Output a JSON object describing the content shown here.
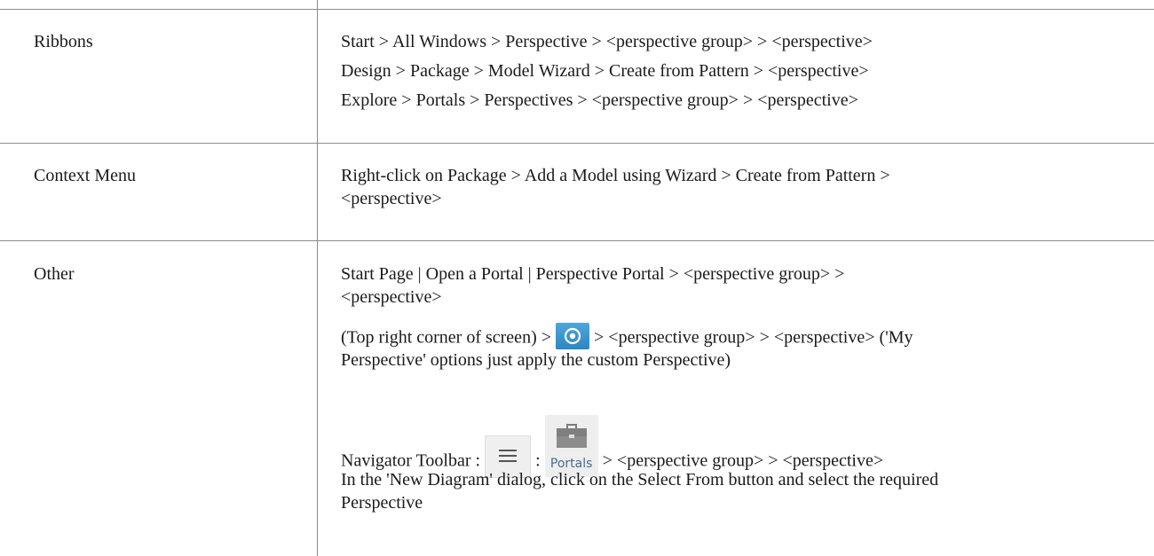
{
  "rows": [
    {
      "label": "Ribbons",
      "lines": [
        "Start > All Windows > Perspective > <perspective group> > <perspective>",
        "Design > Package > Model Wizard > Create from Pattern > <perspective>",
        "Explore > Portals > Perspectives > <perspective group> > <perspective>"
      ]
    },
    {
      "label": "Context Menu",
      "lines": [
        "Right-click on Package > Add a Model using Wizard > Create from Pattern >",
        "<perspective>"
      ]
    },
    {
      "label": "Other",
      "lines": [
        "Start Page | Open a Portal | Perspective Portal > <perspective group> >",
        "<perspective>"
      ],
      "perspective_line": {
        "before_icon": "(Top right corner of screen) > ",
        "icon": "eye-icon",
        "after_icon": " > <perspective group> > <perspective>    ('My",
        "continuation": "Perspective' options just apply the custom Perspective)"
      },
      "toolbar_line": {
        "prefix": "Navigator Toolbar : ",
        "menu_icon": "hamburger-menu-icon",
        "separator": " : ",
        "portals_icon": "briefcase-icon",
        "portals_label": "Portals",
        "suffix": " > <perspective group> > <perspective>"
      },
      "dialog_lines": [
        "In the 'New Diagram' dialog, click on the Select From button and select the required",
        "Perspective"
      ]
    }
  ],
  "colors": {
    "eye_tile": "#3a95cf",
    "rules": "#8c8c8c",
    "portals_text": "#4a6b8a"
  }
}
